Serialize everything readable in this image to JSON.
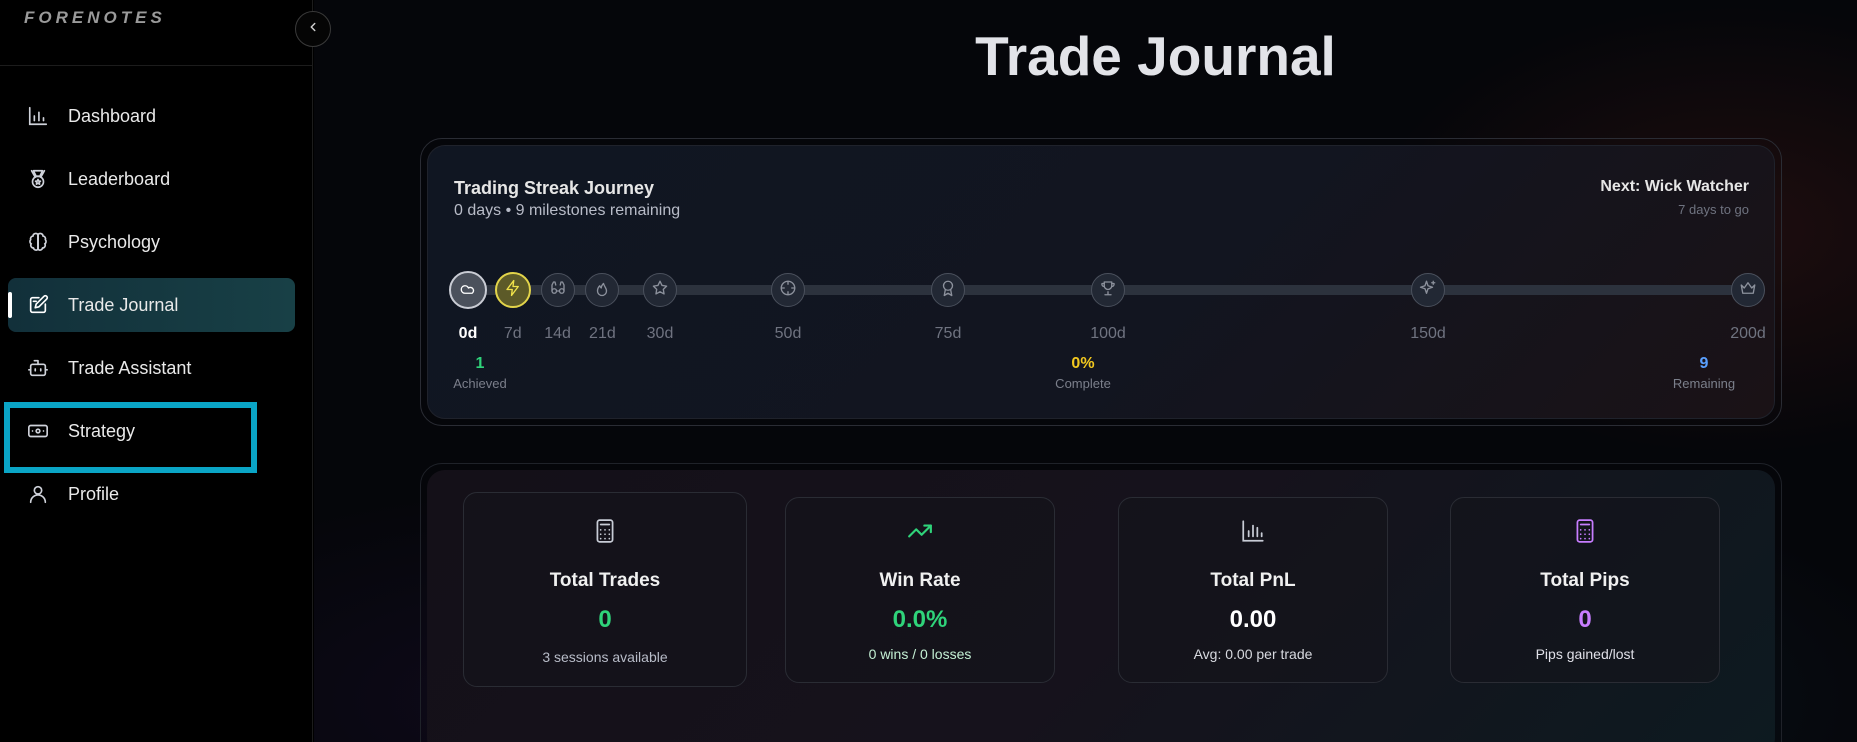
{
  "app": {
    "logo": "FORENOTES"
  },
  "sidebar": {
    "items": [
      {
        "label": "Dashboard",
        "icon": "bar-chart-icon"
      },
      {
        "label": "Leaderboard",
        "icon": "medal-icon"
      },
      {
        "label": "Psychology",
        "icon": "brain-icon"
      },
      {
        "label": "Trade Journal",
        "icon": "journal-edit-icon",
        "active": true
      },
      {
        "label": "Trade Assistant",
        "icon": "bot-icon"
      },
      {
        "label": "Strategy",
        "icon": "banknote-icon",
        "highlighted": true
      },
      {
        "label": "Profile",
        "icon": "user-icon"
      }
    ]
  },
  "page": {
    "title": "Trade Journal"
  },
  "streak": {
    "title": "Trading Streak Journey",
    "subtitle": "0 days • 9 milestones remaining",
    "next_title": "Next: Wick Watcher",
    "next_sub": "7 days to go",
    "milestones": [
      {
        "label": "0d",
        "days": 0,
        "icon": "cloud-icon",
        "state": "achieved"
      },
      {
        "label": "7d",
        "days": 7,
        "icon": "lightning-icon",
        "state": "current"
      },
      {
        "label": "14d",
        "days": 14,
        "icon": "binoculars-icon",
        "state": "locked"
      },
      {
        "label": "21d",
        "days": 21,
        "icon": "flame-icon",
        "state": "locked"
      },
      {
        "label": "30d",
        "days": 30,
        "icon": "star-icon",
        "state": "locked"
      },
      {
        "label": "50d",
        "days": 50,
        "icon": "crosshair-icon",
        "state": "locked"
      },
      {
        "label": "75d",
        "days": 75,
        "icon": "award-icon",
        "state": "locked"
      },
      {
        "label": "100d",
        "days": 100,
        "icon": "trophy-icon",
        "state": "locked"
      },
      {
        "label": "150d",
        "days": 150,
        "icon": "sparkles-icon",
        "state": "locked"
      },
      {
        "label": "200d",
        "days": 200,
        "icon": "crown-icon",
        "state": "locked"
      }
    ],
    "achieved": {
      "value": "1",
      "caption": "Achieved",
      "color": "#2fd37a"
    },
    "complete": {
      "value": "0%",
      "caption": "Complete",
      "color": "#f2c81f"
    },
    "remaining": {
      "value": "9",
      "caption": "Remaining",
      "color": "#5aa0ff"
    }
  },
  "metrics": [
    {
      "label": "Total Trades",
      "value": "0",
      "sub": "3 sessions available",
      "icon": "calculator-icon",
      "color": "#2fd37a"
    },
    {
      "label": "Win Rate",
      "value": "0.0%",
      "sub": "0 wins / 0 losses",
      "icon": "trending-up-icon",
      "color": "#2fd37a"
    },
    {
      "label": "Total PnL",
      "value": "0.00",
      "sub": "Avg: 0.00 per trade",
      "icon": "bar-chart-icon",
      "color": "#ffffff"
    },
    {
      "label": "Total Pips",
      "value": "0",
      "sub": "Pips gained/lost",
      "icon": "calculator-icon",
      "color": "#c77dff"
    }
  ]
}
